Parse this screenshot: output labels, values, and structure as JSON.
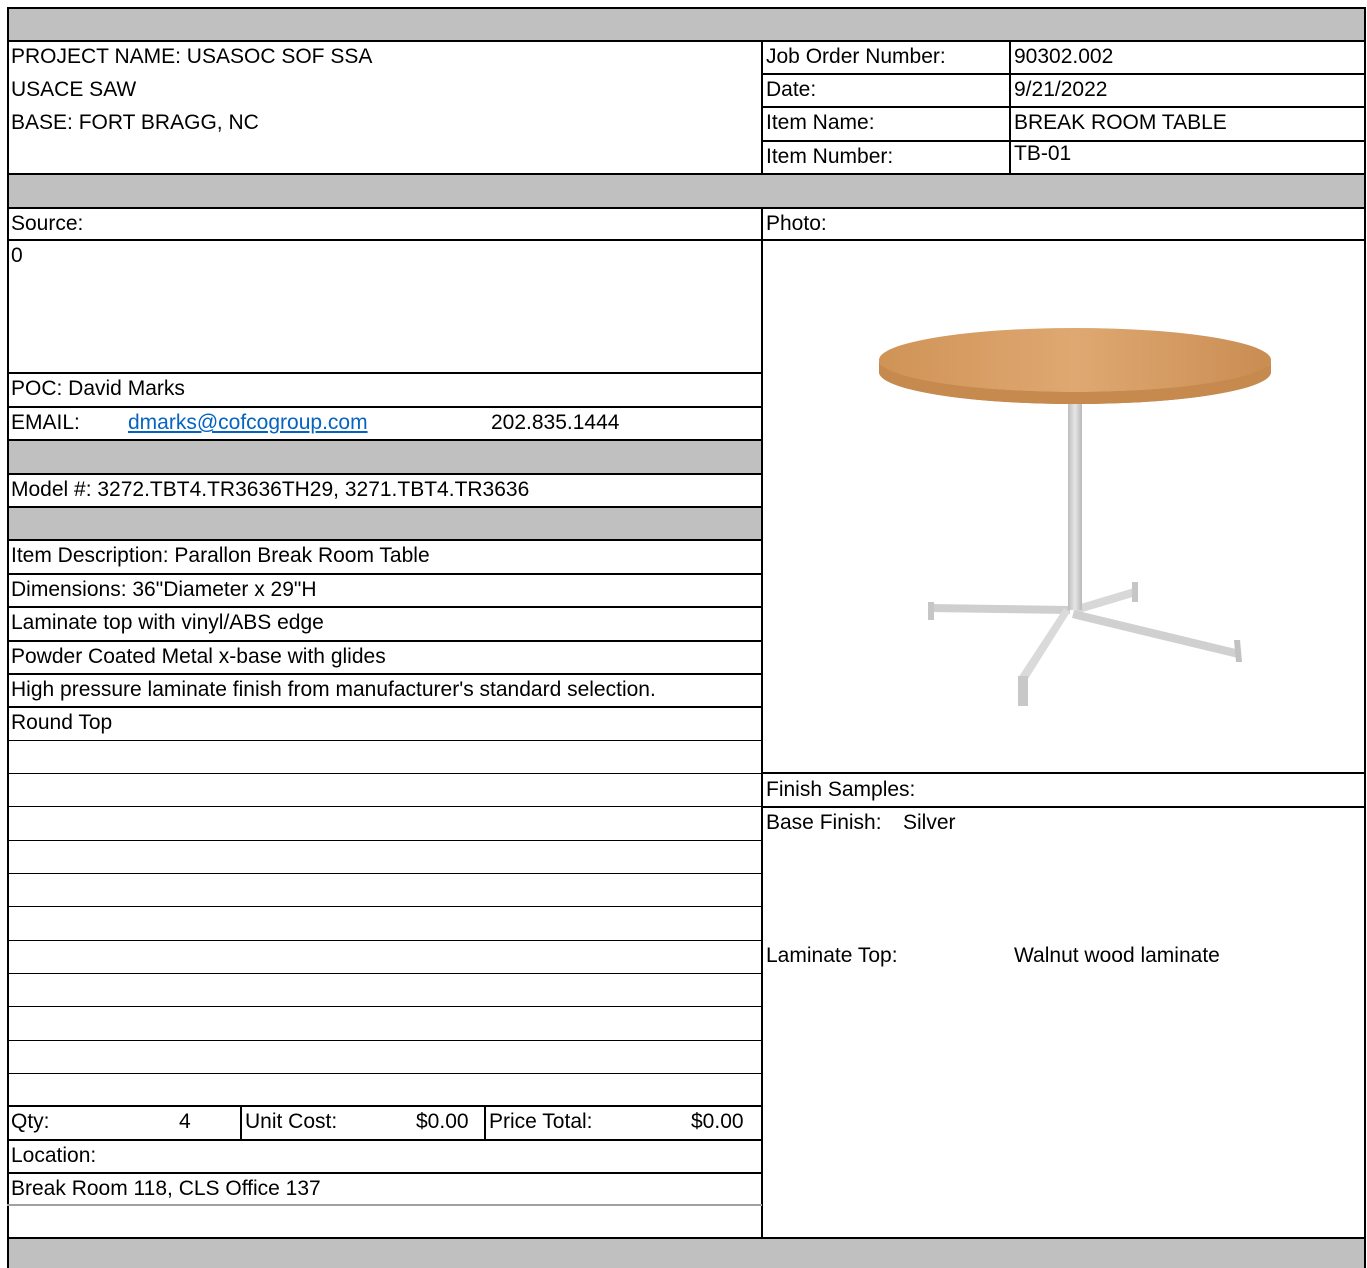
{
  "header": {
    "project_name": "PROJECT NAME: USASOC SOF SSA",
    "agency": "USACE SAW",
    "base": "BASE: FORT BRAGG, NC"
  },
  "info": {
    "job_order_label": "Job Order Number:",
    "job_order_value": "90302.002",
    "date_label": "Date:",
    "date_value": "9/21/2022",
    "item_name_label": "Item Name:",
    "item_name_value": "BREAK ROOM TABLE",
    "item_number_label": "Item Number:",
    "item_number_value": "TB-01"
  },
  "source": {
    "label": "Source:",
    "value": "0",
    "poc": "POC: David Marks",
    "email_label": "EMAIL:",
    "email": "dmarks@cofcogroup.com",
    "phone": "202.835.1444"
  },
  "model": "Model #: 3272.TBT4.TR3636TH29, 3271.TBT4.TR3636",
  "description": [
    "Item Description: Parallon Break Room Table",
    "Dimensions: 36\"Diameter x 29\"H",
    "Laminate top with vinyl/ABS edge",
    "Powder Coated Metal x-base with glides",
    "High pressure laminate finish from manufacturer's standard selection.",
    "Round Top"
  ],
  "pricing": {
    "qty_label": "Qty:",
    "qty_value": "4",
    "unit_cost_label": "Unit Cost:",
    "unit_cost_value": "$0.00",
    "price_total_label": "Price Total:",
    "price_total_value": "$0.00"
  },
  "location": {
    "label": "Location:",
    "value": "Break Room 118, CLS Office 137"
  },
  "photo": {
    "label": "Photo:",
    "top_color": "#d9a06a",
    "base_color": "#d4d4d4"
  },
  "finish": {
    "label": "Finish Samples:",
    "base_label": "Base Finish:",
    "base_value": "Silver",
    "laminate_label": "Laminate Top:",
    "laminate_value": "Walnut wood laminate"
  }
}
